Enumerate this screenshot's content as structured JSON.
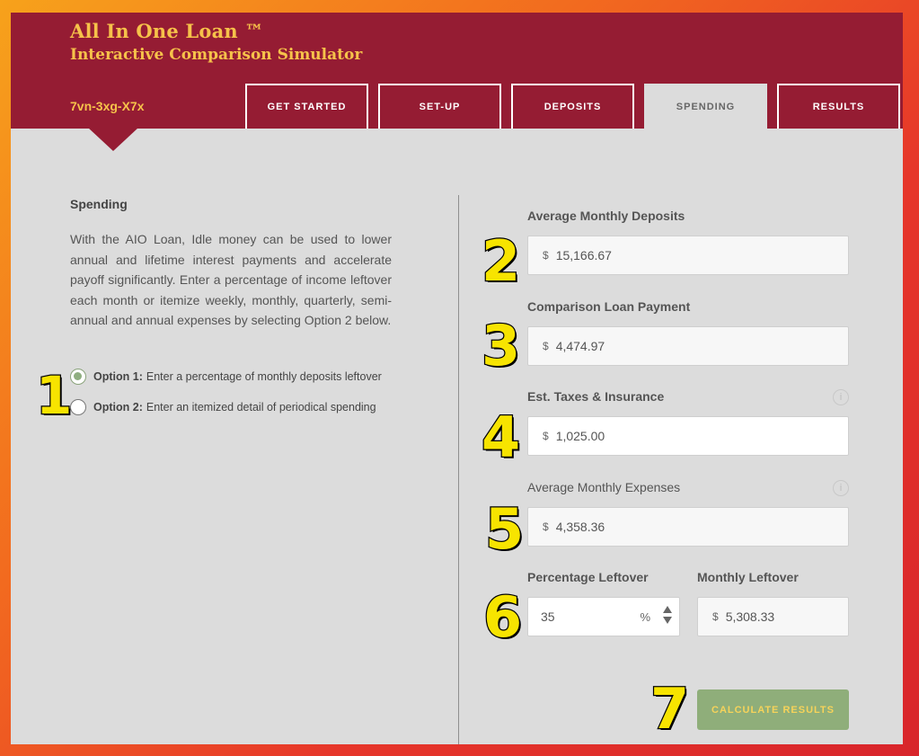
{
  "header": {
    "title": "All In One Loan ™",
    "subtitle": "Interactive Comparison Simulator",
    "code": "7vn-3xg-X7x"
  },
  "tabs": [
    {
      "label": "GET STARTED"
    },
    {
      "label": "SET-UP"
    },
    {
      "label": "DEPOSITS"
    },
    {
      "label": "SPENDING"
    },
    {
      "label": "RESULTS"
    }
  ],
  "spending": {
    "title": "Spending",
    "description": "With the AIO Loan, Idle money can be used to lower annual and lifetime interest payments and accelerate payoff significantly. Enter a percentage of income leftover each month or itemize weekly, monthly, quarterly, semi-annual and annual expenses by selecting Option 2 below.",
    "option1_bold": "Option 1:",
    "option1_text": "Enter a percentage of monthly deposits leftover",
    "option2_bold": "Option 2:",
    "option2_text": "Enter an itemized detail of periodical spending"
  },
  "fields": {
    "currency": "$",
    "deposits_label": "Average Monthly Deposits",
    "deposits_value": "15,166.67",
    "payment_label": "Comparison Loan Payment",
    "payment_value": "4,474.97",
    "taxes_label": "Est. Taxes & Insurance",
    "taxes_value": "1,025.00",
    "expenses_label": "Average Monthly Expenses",
    "expenses_value": "4,358.36",
    "percentage_label": "Percentage Leftover",
    "percentage_value": "35",
    "percent_sign": "%",
    "leftover_label": "Monthly Leftover",
    "leftover_value": "5,308.33",
    "info_glyph": "i"
  },
  "button": {
    "calculate": "CALCULATE RESULTS"
  },
  "annotations": [
    "1",
    "2",
    "3",
    "4",
    "5",
    "6",
    "7"
  ],
  "colors": {
    "header": "#951c33",
    "accent": "#f6c24a",
    "panel": "#dcdcdc",
    "button": "#8fae7a",
    "annotation": "#f7e400"
  }
}
